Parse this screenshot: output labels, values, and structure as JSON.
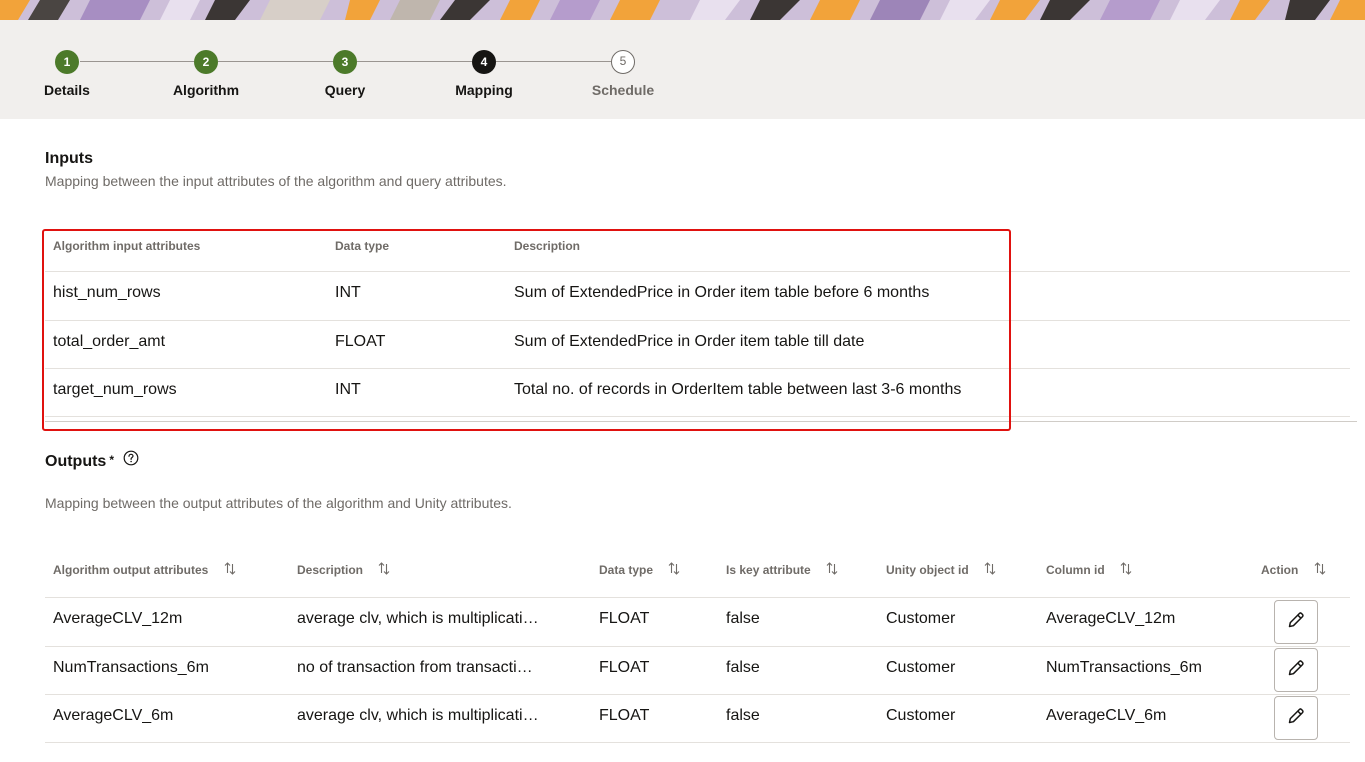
{
  "stepper": {
    "steps": [
      {
        "number": "1",
        "label": "Details",
        "state": "done"
      },
      {
        "number": "2",
        "label": "Algorithm",
        "state": "done"
      },
      {
        "number": "3",
        "label": "Query",
        "state": "done"
      },
      {
        "number": "4",
        "label": "Mapping",
        "state": "current"
      },
      {
        "number": "5",
        "label": "Schedule",
        "state": "todo"
      }
    ]
  },
  "inputs": {
    "title": "Inputs",
    "description": "Mapping between the input attributes of the algorithm and query attributes.",
    "columns": [
      "Algorithm input attributes",
      "Data type",
      "Description"
    ],
    "rows": [
      {
        "attribute": "hist_num_rows",
        "data_type": "INT",
        "description": "Sum of ExtendedPrice in Order item table before 6 months"
      },
      {
        "attribute": "total_order_amt",
        "data_type": "FLOAT",
        "description": "Sum of ExtendedPrice in Order item table till date"
      },
      {
        "attribute": "target_num_rows",
        "data_type": "INT",
        "description": "Total no. of records in OrderItem table between last 3-6 months"
      }
    ]
  },
  "outputs": {
    "title": "Outputs",
    "required_marker": "*",
    "help_icon": "help-circle-icon",
    "description": "Mapping between the output attributes of the algorithm and Unity attributes.",
    "columns": [
      "Algorithm output attributes",
      "Description",
      "Data type",
      "Is key attribute",
      "Unity object id",
      "Column id",
      "Action"
    ],
    "rows": [
      {
        "attribute": "AverageCLV_12m",
        "description": "average clv, which is multiplicati…",
        "data_type": "FLOAT",
        "is_key": "false",
        "unity_object": "Customer",
        "column_id": "AverageCLV_12m"
      },
      {
        "attribute": "NumTransactions_6m",
        "description": "no of transaction from transacti…",
        "data_type": "FLOAT",
        "is_key": "false",
        "unity_object": "Customer",
        "column_id": "NumTransactions_6m"
      },
      {
        "attribute": "AverageCLV_6m",
        "description": "average clv, which is multiplicati…",
        "data_type": "FLOAT",
        "is_key": "false",
        "unity_object": "Customer",
        "column_id": "AverageCLV_6m"
      }
    ],
    "action_icon": "pencil-icon"
  },
  "colors": {
    "step_done": "#4c7a2a",
    "step_current": "#161513",
    "highlight_border": "#e0120f",
    "stepper_background": "#f1efed"
  }
}
